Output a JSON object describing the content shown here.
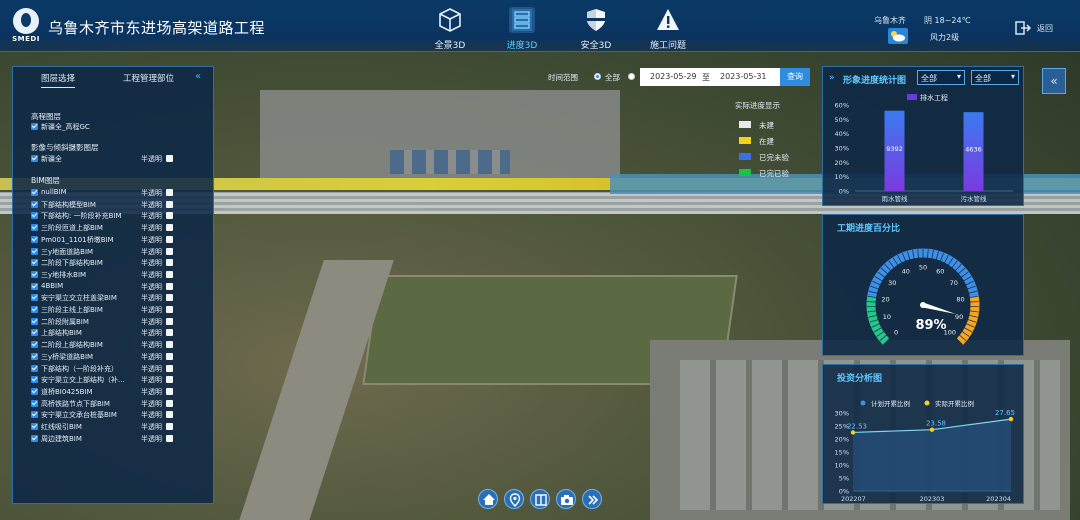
{
  "header": {
    "brand": "SMEDI",
    "title": "乌鲁木齐市东进场高架道路工程",
    "nav": [
      {
        "label": "全景3D",
        "icon": "cube-icon"
      },
      {
        "label": "进度3D",
        "icon": "layers-icon",
        "active": true
      },
      {
        "label": "安全3D",
        "icon": "shield-icon"
      },
      {
        "label": "施工问题",
        "icon": "warning-icon"
      }
    ],
    "weather": {
      "city": "乌鲁木齐",
      "temp": "阴 18~24℃",
      "wind": "风力2级",
      "icon": "cloudy-icon"
    },
    "back_label": "返回"
  },
  "left_panel": {
    "tabs": [
      "图层选择",
      "工程管理部位"
    ],
    "sections": {
      "base": "高程图层",
      "base_item": "新疆全_高程GC",
      "imagery": "影像与倾斜摄影图层",
      "imagery_item": "新疆全",
      "bim": "BIM图层"
    },
    "semi_label": "半透明",
    "bim_layers": [
      "nullBIM",
      "下部结构模型BIM",
      "下部结构: 一阶段补充BIM",
      "三阶段匝道上部BIM",
      "Pm001_1101桥墩BIM",
      "三y地面道路BIM",
      "二阶段下部结构BIM",
      "三y地排水BIM",
      "4BBIM",
      "安宁渠立交立柱盖梁BIM",
      "三阶段主线上部BIM",
      "二阶段附属BIM",
      "上部结构BIM",
      "二阶段上部结构BIM",
      "三y桥梁道路BIM",
      "下部结构（一阶段补充）",
      "安宁渠立交上部结构（补...",
      "道桥BI0425BIM",
      "高桥铁路节点下部BIM",
      "安宁渠立交承台桩基BIM",
      "红线吸引BIM",
      "周边建筑BIM"
    ]
  },
  "time_filter": {
    "label": "时间范围",
    "all_label": "全部",
    "start": "2023-05-29",
    "to": "至",
    "end": "2023-05-31",
    "query_label": "查询"
  },
  "legend": {
    "title": "实际进度显示",
    "items": [
      {
        "label": "未建",
        "color": "#e6e9ec"
      },
      {
        "label": "在建",
        "color": "#f3d21b"
      },
      {
        "label": "已完未验",
        "color": "#3d6fe0"
      },
      {
        "label": "已完已验",
        "color": "#19c24a"
      }
    ]
  },
  "progress_panel": {
    "title": "形象进度统计图",
    "select1": "全部",
    "select2": "全部"
  },
  "schedule_panel": {
    "title": "工期进度百分比"
  },
  "invest_panel": {
    "title": "投资分析图"
  },
  "chart_data": [
    {
      "type": "bar",
      "legend": [
        "排水工程"
      ],
      "categories": [
        "雨水管线",
        "污水管线"
      ],
      "values": [
        56,
        55
      ],
      "labels": [
        "9392",
        "4636"
      ],
      "ylim": [
        0,
        60
      ],
      "yticks": [
        "0%",
        "10%",
        "20%",
        "30%",
        "40%",
        "50%",
        "60%"
      ],
      "colors": [
        "#3a7bf0",
        "#7b3ae0"
      ]
    },
    {
      "type": "gauge",
      "value": 89,
      "display": "89%",
      "ticks": [
        0,
        10,
        20,
        30,
        40,
        50,
        60,
        70,
        80,
        90,
        100
      ],
      "range": [
        0,
        100
      ]
    },
    {
      "type": "line",
      "categories": [
        "202207",
        "202303",
        "202304"
      ],
      "series": [
        {
          "name": "计划开累比例",
          "values": [
            22.53,
            23.58,
            27.65
          ],
          "color": "#7fd8f0"
        },
        {
          "name": "实际开累比例",
          "values": [
            22.53,
            23.58,
            27.65
          ],
          "color": "#f3d21b"
        }
      ],
      "data_labels": [
        "22.53",
        "23.58",
        "27.65"
      ],
      "ylim": [
        0,
        30
      ],
      "yticks": [
        "0%",
        "5%",
        "10%",
        "15%",
        "20%",
        "25%",
        "30%"
      ]
    }
  ]
}
